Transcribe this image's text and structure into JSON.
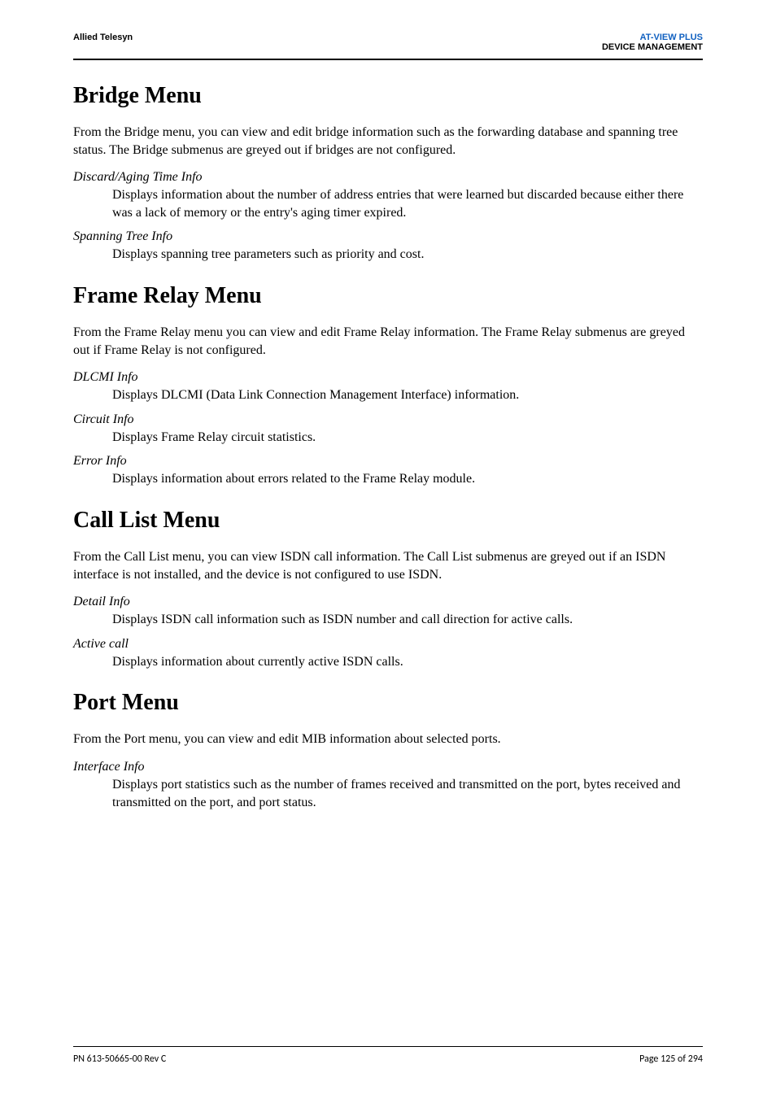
{
  "header": {
    "left": "Allied Telesyn",
    "right_line1": "AT-VIEW PLUS",
    "right_line2": "DEVICE MANAGEMENT"
  },
  "sections": {
    "bridge": {
      "title": "Bridge Menu",
      "intro": "From the Bridge menu, you can view and edit bridge information such as the forwarding database and spanning tree status. The Bridge submenus are greyed out if bridges are not configured.",
      "items": [
        {
          "term": "Discard/Aging Time Info",
          "def": "Displays information about the number of address entries that were learned but discarded because either there was a lack of memory or the entry's aging timer expired."
        },
        {
          "term": "Spanning Tree Info",
          "def": "Displays spanning tree parameters such as priority and cost."
        }
      ]
    },
    "frame_relay": {
      "title": "Frame Relay Menu",
      "intro": "From the Frame Relay menu you can view and edit Frame Relay information. The Frame Relay submenus are greyed out if Frame Relay is not configured.",
      "items": [
        {
          "term": "DLCMI Info",
          "def": "Displays DLCMI (Data Link Connection Management Interface) information."
        },
        {
          "term": "Circuit Info",
          "def": "Displays Frame Relay circuit statistics."
        },
        {
          "term": "Error Info",
          "def": "Displays information about errors related to the Frame Relay module."
        }
      ]
    },
    "call_list": {
      "title": "Call List Menu",
      "intro": "From the Call List menu, you can view ISDN call information. The Call List submenus are greyed out if an ISDN interface is not installed, and the device is not configured to use ISDN.",
      "items": [
        {
          "term": "Detail Info",
          "def": "Displays ISDN call information such as ISDN number and call direction for active calls."
        },
        {
          "term": "Active call",
          "def": "Displays information about currently active ISDN calls."
        }
      ]
    },
    "port": {
      "title": "Port Menu",
      "intro": "From the Port menu, you can view and edit MIB information about selected ports.",
      "items": [
        {
          "term": "Interface Info",
          "def": "Displays port statistics such as the number of frames received and transmitted on the port, bytes received and transmitted on the port, and port status."
        }
      ]
    }
  },
  "footer": {
    "left": "PN 613-50665-00 Rev C",
    "right": "Page 125 of 294"
  }
}
